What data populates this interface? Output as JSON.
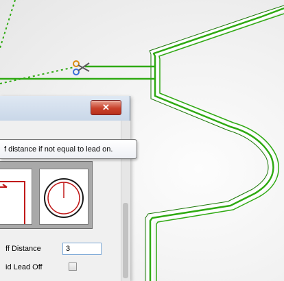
{
  "dialog": {
    "close_label": "✕",
    "tooltip_text": "f distance if not equal to lead on.",
    "fields": {
      "lead_off_distance_label": "ff Distance",
      "lead_off_distance_value": "3",
      "avoid_lead_off_label": "id Lead Off"
    }
  },
  "colors": {
    "toolpath_green": "#2faa12",
    "part_outline": "#ffffff",
    "preview_red": "#c01818",
    "close_red": "#c8412b"
  },
  "icons": {
    "toolpath_marker": "scissors-icon",
    "preview_lead": "lead-preview-icon",
    "preview_tool": "tool-circle-icon"
  }
}
